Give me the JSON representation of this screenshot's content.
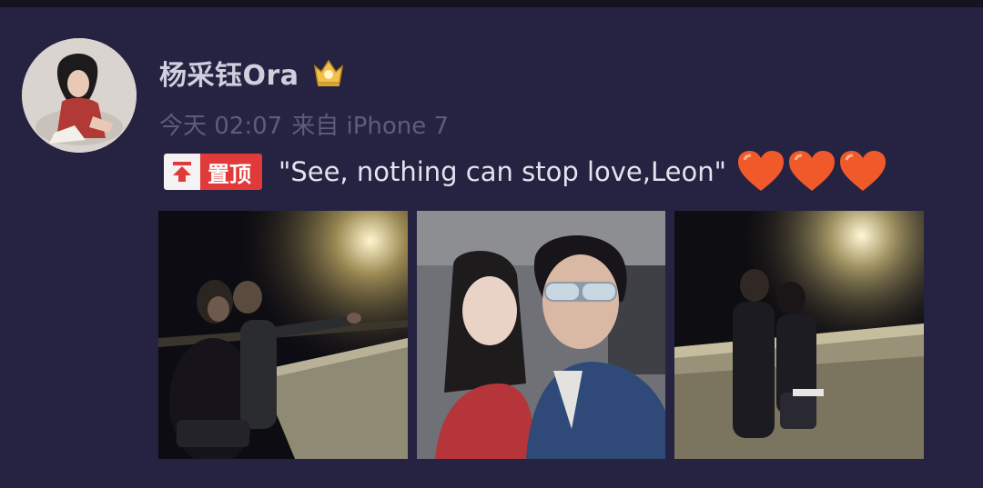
{
  "post": {
    "username": "杨采钰Ora",
    "time": "今天 02:07",
    "source": "来自 iPhone 7",
    "pinned_label": "置顶",
    "text": "\"See, nothing can stop love,Leon\""
  },
  "icons": {
    "badge": "crown-vip-icon",
    "pin": "pin-up-arrow-icon",
    "hearts": [
      "heart-icon",
      "heart-icon",
      "heart-icon"
    ]
  },
  "photos": [
    {
      "label": "night-bridge-photo-1"
    },
    {
      "label": "selfie-couple-photo"
    },
    {
      "label": "night-bridge-photo-2"
    }
  ],
  "colors": {
    "background": "#262241",
    "username": "#cfd0de",
    "meta": "#5e5d78",
    "pin_red": "#e03a3a",
    "heart": "#f05a2a"
  }
}
